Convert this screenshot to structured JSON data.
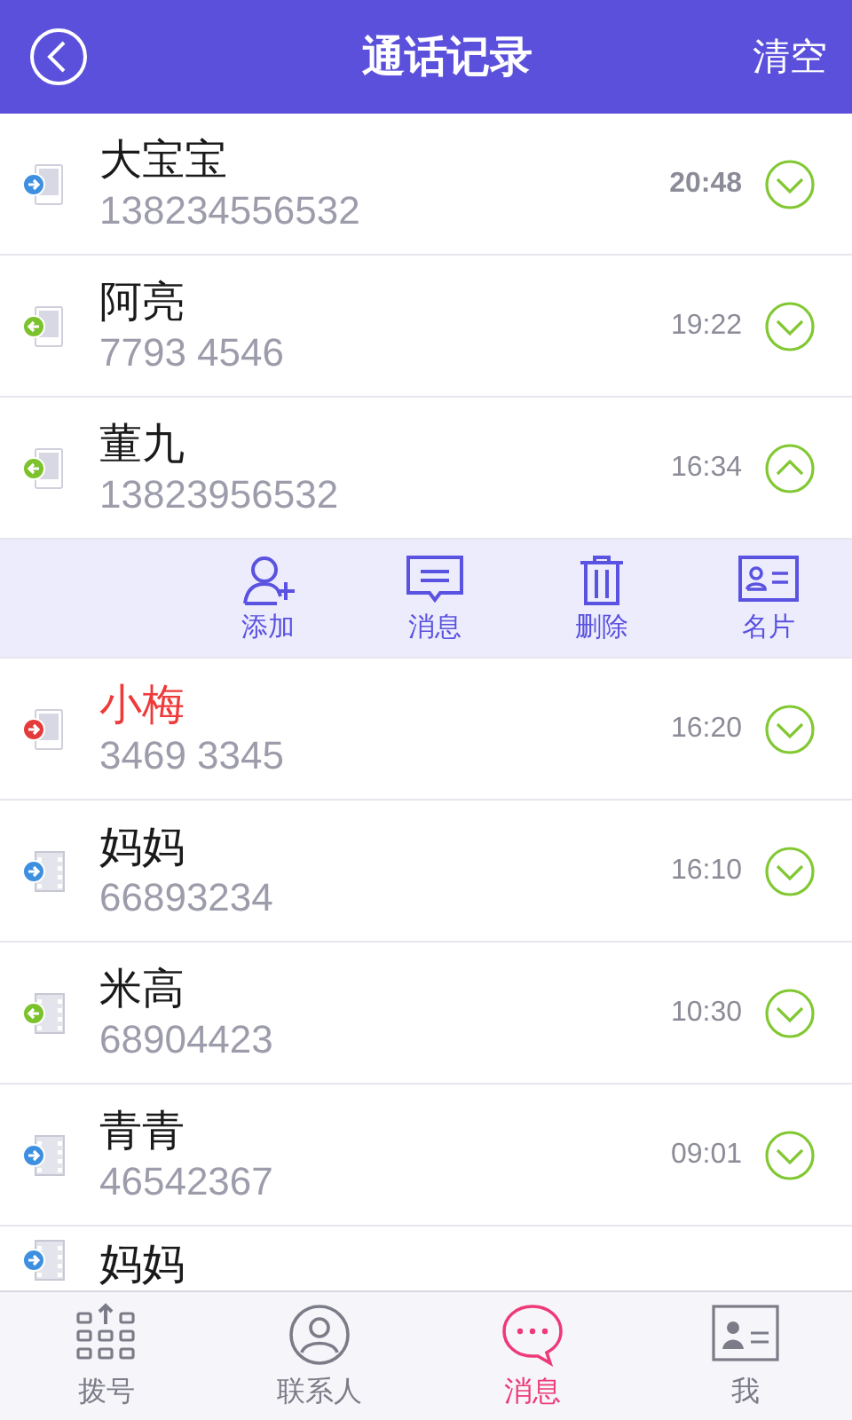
{
  "header": {
    "title": "通话记录",
    "action": "清空"
  },
  "calls": [
    {
      "name": "大宝宝",
      "number": "138234556532",
      "time": "20:48",
      "kind": "outgoing",
      "video": false,
      "unread": true,
      "expanded": false
    },
    {
      "name": "阿亮",
      "number": "7793 4546",
      "time": "19:22",
      "kind": "incoming",
      "video": false,
      "unread": false,
      "expanded": false
    },
    {
      "name": "董九",
      "number": "13823956532",
      "time": "16:34",
      "kind": "incoming",
      "video": false,
      "unread": false,
      "expanded": true
    },
    {
      "name": "小梅",
      "number": "3469 3345",
      "time": "16:20",
      "kind": "missed",
      "video": false,
      "unread": false,
      "expanded": false
    },
    {
      "name": "妈妈",
      "number": "66893234",
      "time": "16:10",
      "kind": "outgoing",
      "video": true,
      "unread": false,
      "expanded": false
    },
    {
      "name": "米高",
      "number": "68904423",
      "time": "10:30",
      "kind": "incoming",
      "video": true,
      "unread": false,
      "expanded": false
    },
    {
      "name": "青青",
      "number": "46542367",
      "time": "09:01",
      "kind": "outgoing",
      "video": true,
      "unread": false,
      "expanded": false
    },
    {
      "name": "妈妈",
      "kind": "outgoing",
      "video": true
    }
  ],
  "actions": [
    {
      "kind": "add",
      "label": "添加"
    },
    {
      "kind": "message",
      "label": "消息"
    },
    {
      "kind": "delete",
      "label": "删除"
    },
    {
      "kind": "card",
      "label": "名片"
    }
  ],
  "tabs": [
    {
      "kind": "dialpad",
      "label": "拨号",
      "selected": false
    },
    {
      "kind": "contact",
      "label": "联系人",
      "selected": false
    },
    {
      "kind": "message",
      "label": "消息",
      "selected": true
    },
    {
      "kind": "card",
      "label": "我",
      "selected": false
    }
  ]
}
